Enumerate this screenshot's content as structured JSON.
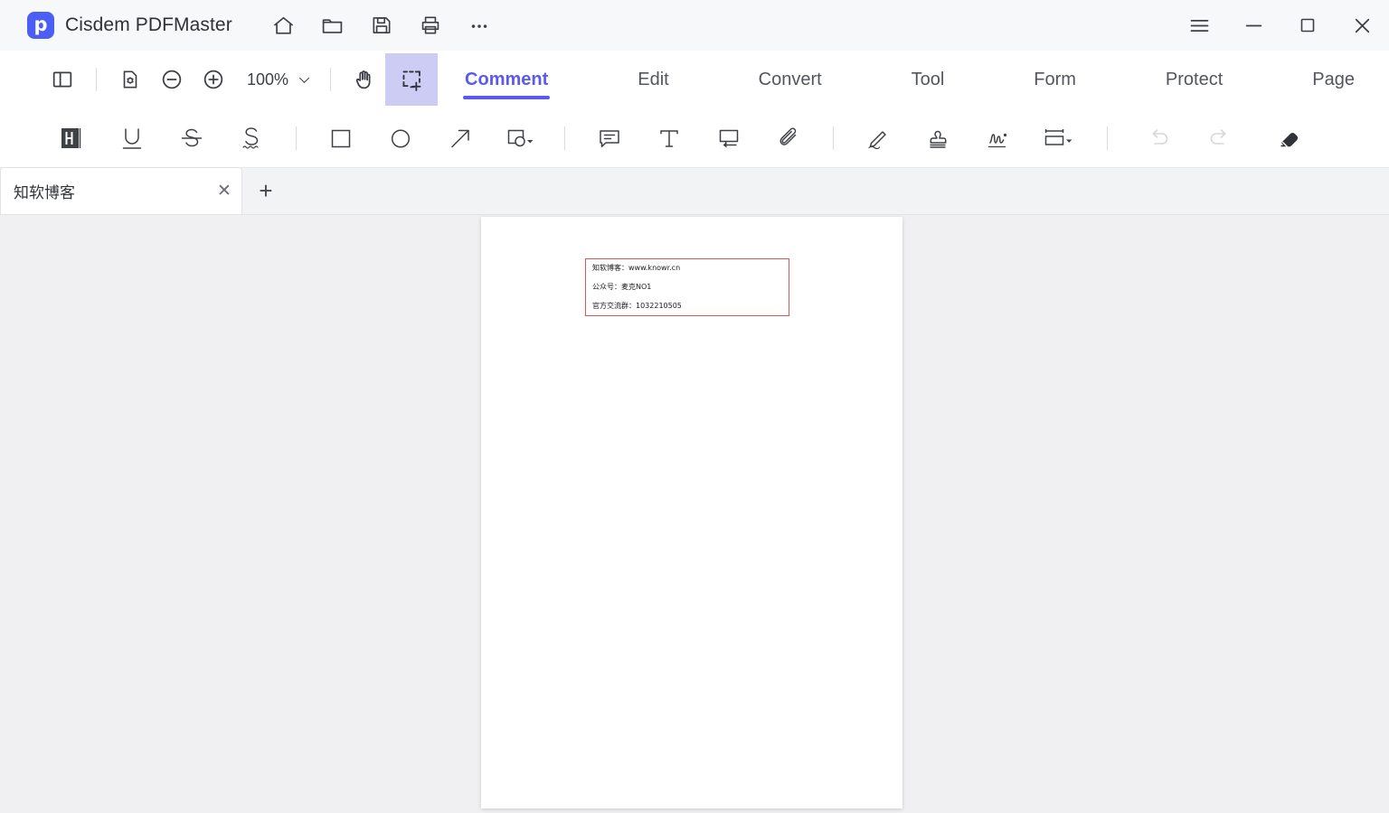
{
  "app": {
    "title": "Cisdem PDFMaster",
    "logo_letter": "p",
    "brand_color": "#4b5ef5",
    "accent_color": "#5a5af0",
    "quick_icons": [
      {
        "name": "home-icon",
        "label": "Home"
      },
      {
        "name": "open-folder-icon",
        "label": "Open"
      },
      {
        "name": "save-icon",
        "label": "Save"
      },
      {
        "name": "print-icon",
        "label": "Print"
      },
      {
        "name": "more-options-icon",
        "label": "More"
      }
    ],
    "window_controls": [
      {
        "name": "menu-icon",
        "label": "Menu"
      },
      {
        "name": "minimize-icon",
        "label": "Minimize"
      },
      {
        "name": "maximize-icon",
        "label": "Maximize"
      },
      {
        "name": "close-icon",
        "label": "Close"
      }
    ]
  },
  "toolbar": {
    "sidebar_toggle": "Toggle sidebar",
    "page_settings": "Page settings",
    "zoom_out": "Zoom out",
    "zoom_in": "Zoom in",
    "zoom_level": "100%",
    "hand_tool": "Hand tool",
    "select_area_tool": "Select area",
    "selected_tool": "select-area"
  },
  "tabs": [
    {
      "label": "Comment",
      "active": true
    },
    {
      "label": "Edit",
      "active": false
    },
    {
      "label": "Convert",
      "active": false
    },
    {
      "label": "Tool",
      "active": false
    },
    {
      "label": "Form",
      "active": false
    },
    {
      "label": "Protect",
      "active": false
    },
    {
      "label": "Page",
      "active": false
    }
  ],
  "annotation_tools": [
    {
      "name": "highlight-icon",
      "label": "Highlight",
      "disabled": false
    },
    {
      "name": "underline-icon",
      "label": "Underline",
      "disabled": false
    },
    {
      "name": "strikethrough-icon",
      "label": "Strikethrough",
      "disabled": false
    },
    {
      "name": "squiggly-underline-icon",
      "label": "Squiggly underline",
      "disabled": false
    },
    {
      "name": "rectangle-icon",
      "label": "Rectangle",
      "disabled": false
    },
    {
      "name": "ellipse-icon",
      "label": "Ellipse",
      "disabled": false
    },
    {
      "name": "arrow-icon",
      "label": "Arrow",
      "disabled": false
    },
    {
      "name": "shapes-dropdown-icon",
      "label": "More shapes",
      "disabled": false
    },
    {
      "name": "sticky-note-icon",
      "label": "Note",
      "disabled": false
    },
    {
      "name": "text-icon",
      "label": "Text",
      "disabled": false
    },
    {
      "name": "text-box-icon",
      "label": "Text box",
      "disabled": false
    },
    {
      "name": "attachment-icon",
      "label": "Attachment",
      "disabled": false
    },
    {
      "name": "pencil-icon",
      "label": "Pencil",
      "disabled": false
    },
    {
      "name": "stamp-icon",
      "label": "Stamp",
      "disabled": false
    },
    {
      "name": "signature-icon",
      "label": "Signature",
      "disabled": false
    },
    {
      "name": "measure-dropdown-icon",
      "label": "Measure",
      "disabled": false
    },
    {
      "name": "undo-icon",
      "label": "Undo",
      "disabled": true
    },
    {
      "name": "redo-icon",
      "label": "Redo",
      "disabled": true
    },
    {
      "name": "eraser-icon",
      "label": "Eraser",
      "disabled": false
    }
  ],
  "document_tabs": {
    "items": [
      {
        "label": "知软博客",
        "close_label": "✕"
      }
    ],
    "new_tab_label": "+"
  },
  "document": {
    "annotation_box": {
      "border_color": "#e1544f",
      "lines": [
        "知软博客：www.knowr.cn",
        "公众号：麦克NO1",
        "官方交流群：1032210505"
      ]
    }
  }
}
